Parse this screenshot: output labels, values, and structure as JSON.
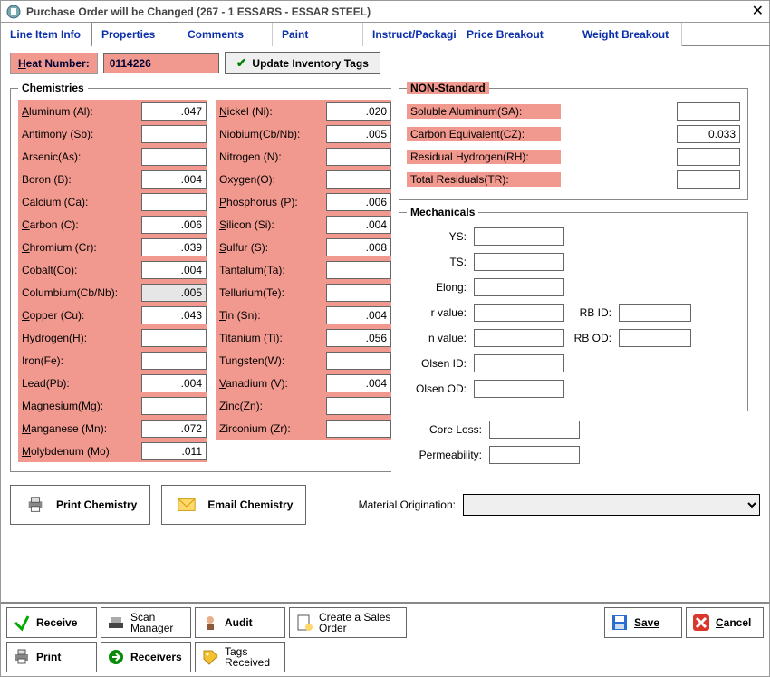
{
  "window": {
    "title": "Purchase Order will be Changed  (267 - 1  ESSARS -  ESSAR STEEL)"
  },
  "tabs": {
    "line_item_info": "Line Item Info",
    "properties": "Properties",
    "comments": "Comments",
    "paint": "Paint",
    "instruct_packaging": "Instruct/Packaging",
    "price_breakout": "Price Breakout",
    "weight_breakout": "Weight Breakout"
  },
  "heat": {
    "label": "Heat Number:",
    "value": "0114226",
    "update_btn": "Update Inventory Tags"
  },
  "chem_legend": "Chemistries",
  "chem1": {
    "aluminum": {
      "label": "Aluminum (Al):",
      "value": ".047"
    },
    "antimony": {
      "label": "Antimony (Sb):",
      "value": ""
    },
    "arsenic": {
      "label": "Arsenic(As):",
      "value": ""
    },
    "boron": {
      "label": "Boron (B):",
      "value": ".004"
    },
    "calcium": {
      "label": "Calcium (Ca):",
      "value": ""
    },
    "carbon": {
      "label": "Carbon (C):",
      "value": ".006"
    },
    "chromium": {
      "label": "Chromium (Cr):",
      "value": ".039"
    },
    "cobalt": {
      "label": "Cobalt(Co):",
      "value": ".004"
    },
    "columbium": {
      "label": "Columbium(Cb/Nb):",
      "value": ".005"
    },
    "copper": {
      "label": "Copper (Cu):",
      "value": ".043"
    },
    "hydrogen": {
      "label": "Hydrogen(H):",
      "value": ""
    },
    "iron": {
      "label": "Iron(Fe):",
      "value": ""
    },
    "lead": {
      "label": "Lead(Pb):",
      "value": ".004"
    },
    "magnesium": {
      "label": "Magnesium(Mg):",
      "value": ""
    },
    "manganese": {
      "label": "Manganese (Mn):",
      "value": ".072"
    },
    "molybdenum": {
      "label": "Molybdenum (Mo):",
      "value": ".011"
    }
  },
  "chem2": {
    "nickel": {
      "label": "Nickel (Ni):",
      "value": ".020"
    },
    "niobium": {
      "label": "Niobium(Cb/Nb):",
      "value": ".005"
    },
    "nitrogen": {
      "label": "Nitrogen (N):",
      "value": ""
    },
    "oxygen": {
      "label": "Oxygen(O):",
      "value": ""
    },
    "phosphorus": {
      "label": "Phosphorus (P):",
      "value": ".006"
    },
    "silicon": {
      "label": "Silicon (Si):",
      "value": ".004"
    },
    "sulfur": {
      "label": "Sulfur (S):",
      "value": ".008"
    },
    "tantalum": {
      "label": "Tantalum(Ta):",
      "value": ""
    },
    "tellurium": {
      "label": "Tellurium(Te):",
      "value": ""
    },
    "tin": {
      "label": "Tin (Sn):",
      "value": ".004"
    },
    "titanium": {
      "label": "Titanium (Ti):",
      "value": ".056"
    },
    "tungsten": {
      "label": "Tungsten(W):",
      "value": ""
    },
    "vanadium": {
      "label": "Vanadium (V):",
      "value": ".004"
    },
    "zinc": {
      "label": "Zinc(Zn):",
      "value": ""
    },
    "zirconium": {
      "label": "Zirconium (Zr):",
      "value": ""
    }
  },
  "nonstd": {
    "legend": "NON-Standard",
    "soluble_al": {
      "label": "Soluble Aluminum(SA):",
      "value": ""
    },
    "carbon_eq": {
      "label": "Carbon Equivalent(CZ):",
      "value": "0.033"
    },
    "resid_h": {
      "label": "Residual Hydrogen(RH):",
      "value": ""
    },
    "total_res": {
      "label": "Total Residuals(TR):",
      "value": ""
    }
  },
  "mech": {
    "legend": "Mechanicals",
    "ys": "YS:",
    "ts": "TS:",
    "elong": "Elong:",
    "rvalue": "r value:",
    "rbid": "RB ID:",
    "nvalue": "n value:",
    "rbod": "RB OD:",
    "olsen_id": "Olsen ID:",
    "olsen_od": "Olsen OD:"
  },
  "below": {
    "core_loss": "Core Loss:",
    "permeability": "Permeability:"
  },
  "buttons": {
    "print_chem": "Print Chemistry",
    "email_chem": "Email Chemistry",
    "mat_orig": "Material Origination:"
  },
  "bottom": {
    "receive": "Receive",
    "scan_mgr": "Scan Manager",
    "audit": "Audit",
    "create_so": "Create a Sales Order",
    "save": "Save",
    "cancel": "Cancel",
    "print": "Print",
    "receivers": "Receivers",
    "tags_recv": "Tags Received"
  }
}
